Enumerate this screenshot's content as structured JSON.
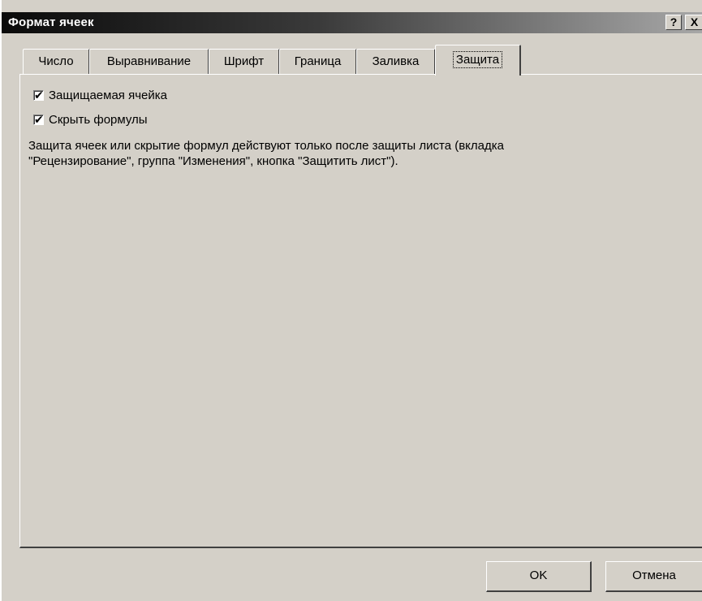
{
  "window": {
    "title": "Формат ячеек",
    "help_label": "?",
    "close_label": "X"
  },
  "tabs": [
    {
      "label": "Число"
    },
    {
      "label": "Выравнивание"
    },
    {
      "label": "Шрифт"
    },
    {
      "label": "Граница"
    },
    {
      "label": "Заливка"
    },
    {
      "label": "Защита",
      "active": true
    }
  ],
  "protection": {
    "locked": {
      "label": "Защищаемая ячейка",
      "checked": true
    },
    "hidden": {
      "label": "Скрыть формулы",
      "checked": true
    },
    "info_line1": "Защита ячеек или скрытие формул действуют только после защиты листа (вкладка",
    "info_line2": "\"Рецензирование\", группа \"Изменения\", кнопка \"Защитить лист\")."
  },
  "buttons": {
    "ok_label": "OK",
    "cancel_label": "Отмена"
  }
}
